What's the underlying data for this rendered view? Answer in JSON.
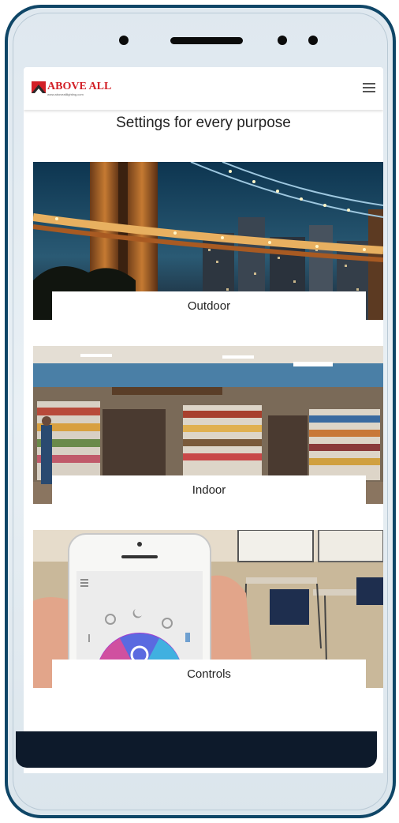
{
  "header": {
    "logo_text": "ABOVE ALL",
    "logo_subtext": "www.abovealllighting.com",
    "menu_icon": "hamburger-icon"
  },
  "main": {
    "heading": "Settings for every purpose",
    "cards": [
      {
        "label": "Outdoor"
      },
      {
        "label": "Indoor"
      },
      {
        "label": "Controls"
      }
    ]
  },
  "colors": {
    "phone_frame": "#0f4667",
    "logo_red": "#d21f26",
    "footer_bar": "#0d1a2b"
  }
}
